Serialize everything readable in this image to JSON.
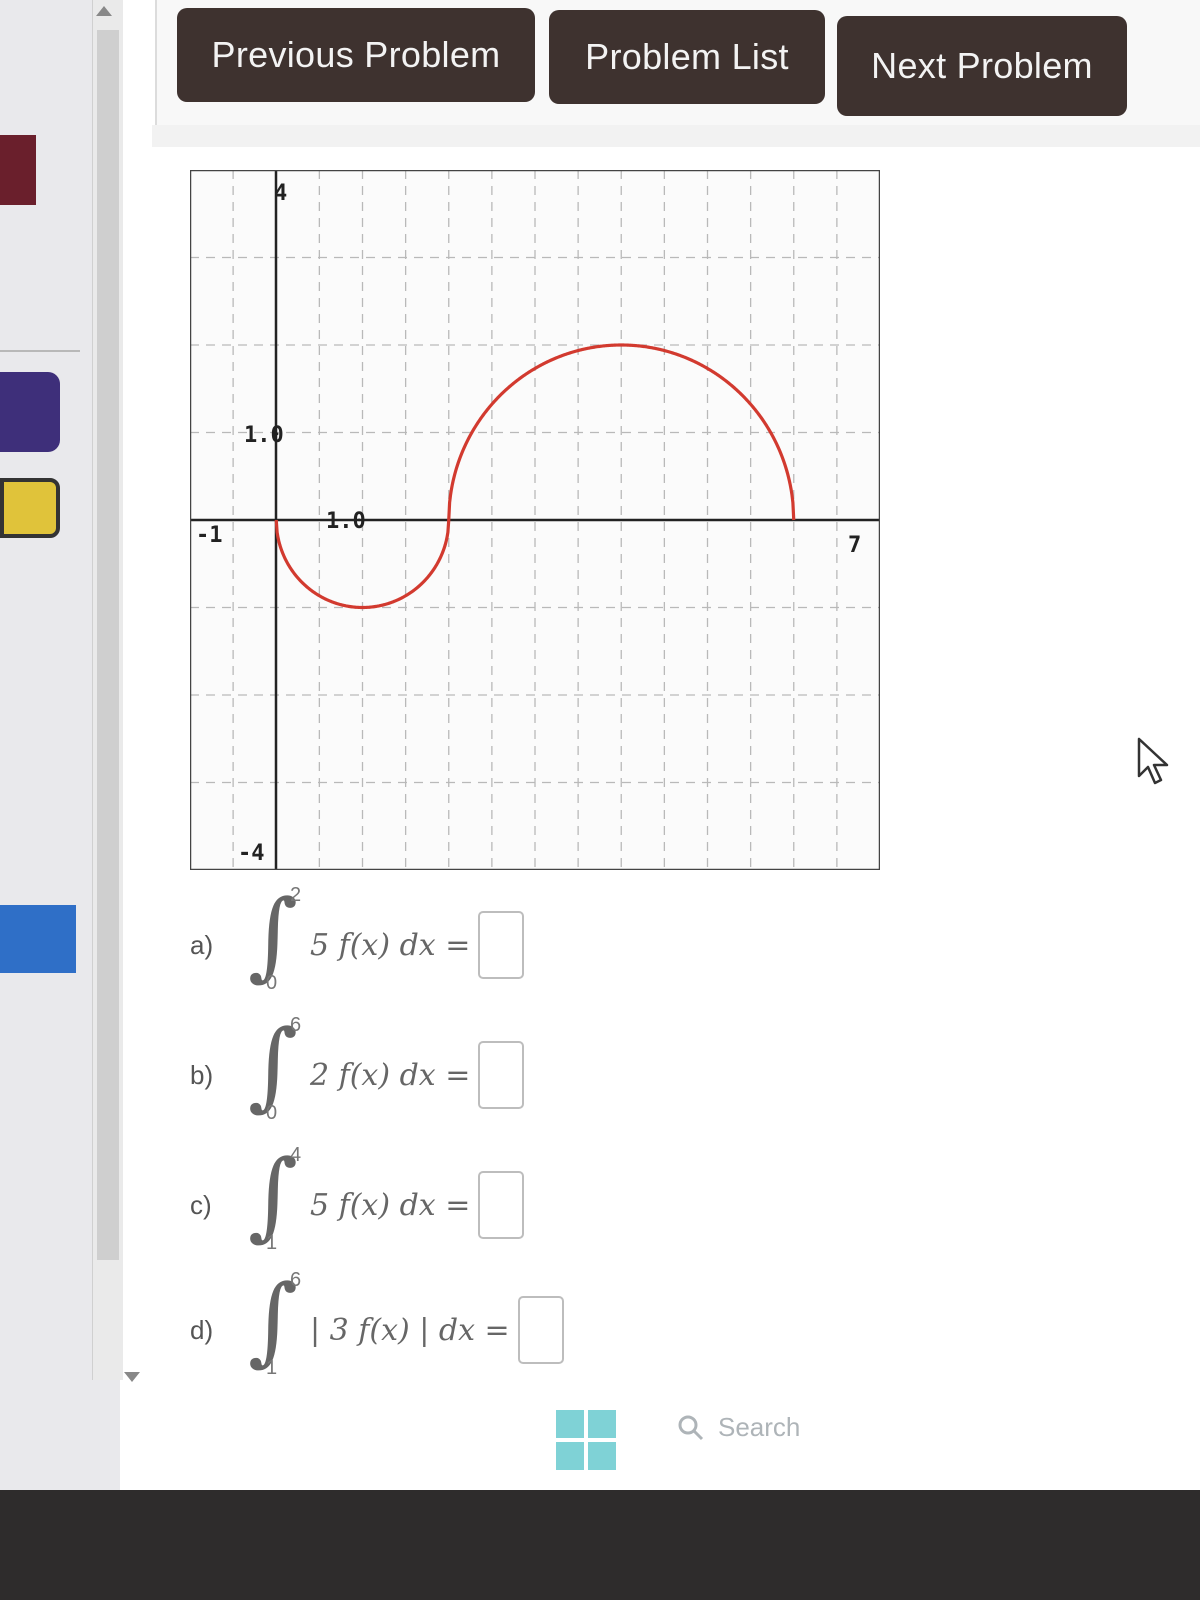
{
  "nav": {
    "previous": "Previous Problem",
    "list": "Problem List",
    "next": "Next Problem"
  },
  "graph": {
    "y_max_label": "4",
    "y_min_label": "-4",
    "x_min_label": "-1",
    "x_max_label": "7",
    "y_unit_label": "1.0",
    "x_unit_label": "1.0",
    "curve_color": "#d23a2f"
  },
  "problems": [
    {
      "label": "a)",
      "lower": "0",
      "upper": "2",
      "integrand": "5 f(x) dx ="
    },
    {
      "label": "b)",
      "lower": "0",
      "upper": "6",
      "integrand": "2 f(x) dx ="
    },
    {
      "label": "c)",
      "lower": "1",
      "upper": "4",
      "integrand": "5 f(x) dx ="
    },
    {
      "label": "d)",
      "lower": "1",
      "upper": "6",
      "integrand": "| 3 f(x) | dx ="
    }
  ],
  "taskbar": {
    "search_placeholder": "Search",
    "windows_icon": "windows-start-icon",
    "search_icon": "search-icon"
  },
  "colors": {
    "button_bg": "#3e322f",
    "accent_blue": "#2f6fc7",
    "accent_purple": "#3e2f7a",
    "accent_red": "#6a1f2c",
    "accent_yellow": "#e0c33a"
  }
}
